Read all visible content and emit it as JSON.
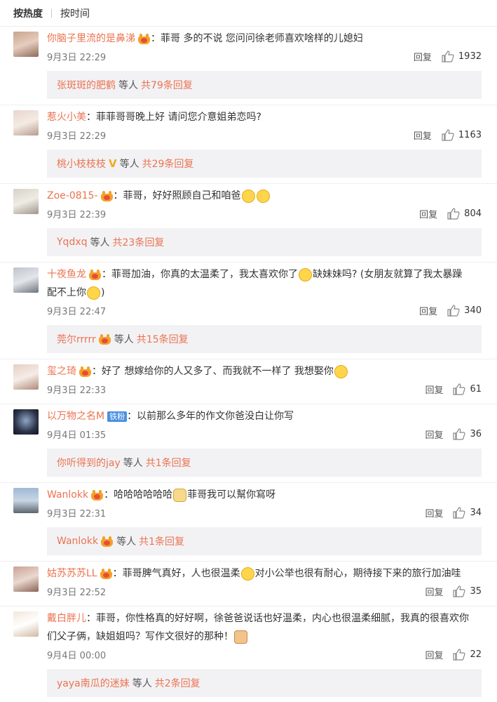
{
  "sort": {
    "hot": "按热度",
    "time": "按时间"
  },
  "reply_label": "回复",
  "sub_sep": "等人",
  "comments": [
    {
      "user": "你脑子里流的是鼻涕",
      "text": "：菲哥 多的不说 您问问徐老师喜欢啥样的儿媳妇",
      "time": "9月3日 22:29",
      "likes": "1932",
      "sub": {
        "name": "张斑斑的肥鹤",
        "count": "共79条回复"
      }
    },
    {
      "user": "惹火小美",
      "text": "：菲菲哥哥晚上好 请问您介意姐弟恋吗?",
      "time": "9月3日 22:29",
      "likes": "1163",
      "sub": {
        "name": "桃小枝枝枝",
        "count": "共29条回复"
      }
    },
    {
      "user": "Zoe-0815-",
      "text": "：菲哥，好好照顾自己和咱爸",
      "time": "9月3日 22:39",
      "likes": "804",
      "sub": {
        "name": "Yqdxq",
        "count": "共23条回复"
      }
    },
    {
      "user": "十夜鱼龙",
      "text1": "：菲哥加油，你真的太温柔了，我太喜欢你了",
      "text1b": "缺妹妹吗? (女朋友就算了我太暴躁",
      "text2": "配不上你",
      "text2b": ")",
      "time": "9月3日 22:47",
      "likes": "340",
      "sub": {
        "name": "莞尔rrrrr",
        "count": "共15条回复"
      }
    },
    {
      "user": "玺之琦",
      "text": "：好了 想嫁给你的人又多了、而我就不一样了 我想娶你",
      "time": "9月3日 22:33",
      "likes": "61"
    },
    {
      "user": "以万物之名M",
      "badge": "铁粉",
      "text": "：以前那么多年的作文你爸没白让你写",
      "time": "9月4日 01:35",
      "likes": "36",
      "sub": {
        "name": "你听得到的jay",
        "count": "共1条回复"
      }
    },
    {
      "user": "Wanlokk",
      "text": "：哈哈哈哈哈哈",
      "textb": "菲哥我可以幫你寫呀",
      "time": "9月3日 22:31",
      "likes": "34",
      "sub": {
        "name": "Wanlokk",
        "count": "共1条回复"
      }
    },
    {
      "user": "姑苏苏苏LL",
      "text": "：菲哥脾气真好，人也很温柔",
      "textb": "对小公举也很有耐心，期待接下来的旅行加油哇",
      "time": "9月3日 22:52",
      "likes": "35"
    },
    {
      "user": "戴白胖儿",
      "text1": "：菲哥，你性格真的好好啊，徐爸爸说话也好温柔，内心也很温柔细腻，我真的很喜欢你",
      "text2": "们父子俩，缺姐姐吗？写作文很好的那种！",
      "time": "9月4日 00:00",
      "likes": "22",
      "sub": {
        "name": "yaya南瓜的迷妹",
        "count": "共2条回复"
      }
    }
  ],
  "colors": {
    "accent": "#eb7350",
    "sub_bg": "#f2f2f5",
    "fan_badge": "#4a90e2"
  }
}
